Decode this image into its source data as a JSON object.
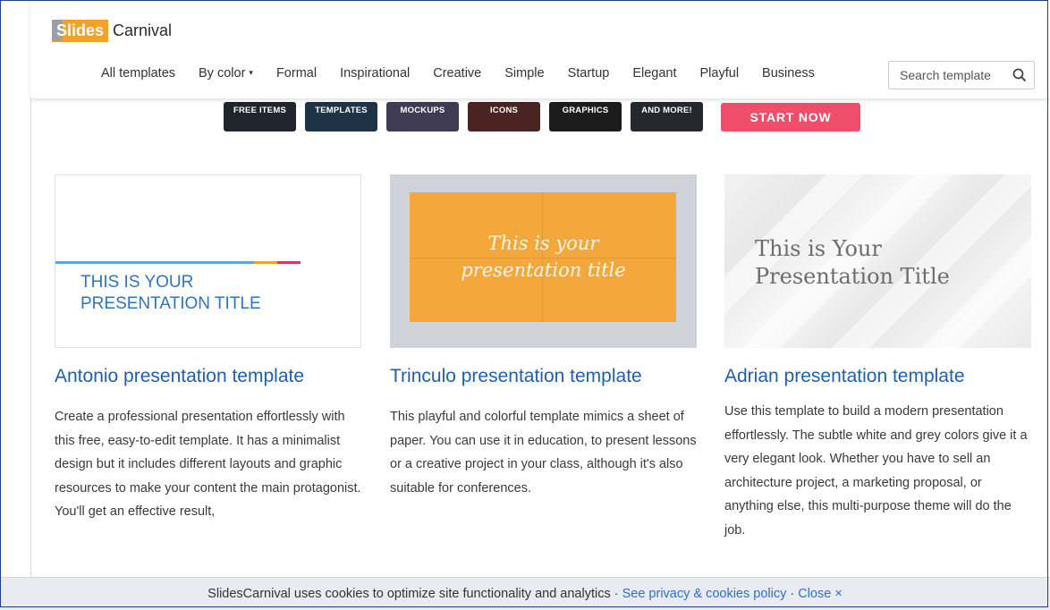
{
  "brand": {
    "slides": "Slides",
    "carnival": "Carnival",
    "accent": "#f2a12c"
  },
  "nav": {
    "items": [
      "All templates",
      "By color",
      "Formal",
      "Inspirational",
      "Creative",
      "Simple",
      "Startup",
      "Elegant",
      "Playful",
      "Business"
    ],
    "caret": "▾"
  },
  "search": {
    "placeholder": "Search template",
    "icon": "search-icon"
  },
  "banner": {
    "tiles": [
      {
        "label": "FREE ITEMS",
        "color": "#20242c"
      },
      {
        "label": "TEMPLATES",
        "color": "#1f3346"
      },
      {
        "label": "MOCKUPS",
        "color": "#3e3b52"
      },
      {
        "label": "ICONS",
        "color": "#4a2420"
      },
      {
        "label": "GRAPHICS",
        "color": "#1c1c1c"
      },
      {
        "label": "AND MORE!",
        "color": "#24282e"
      }
    ],
    "cta": "START NOW",
    "cta_color": "#ef4e6b"
  },
  "cards": [
    {
      "thumb_title_line1": "THIS IS YOUR",
      "thumb_title_line2": "PRESENTATION TITLE",
      "title": "Antonio presentation template",
      "description": "Create a professional presentation effortlessly with this free, easy-to-edit template. It has a minimalist design but it includes different layouts and graphic resources to make your content the main protagonist. You'll get an effective result,"
    },
    {
      "thumb_title_line1": "This is your",
      "thumb_title_line2": "presentation title",
      "title": "Trinculo presentation template",
      "description": "This playful and colorful template mimics a sheet of paper. You can use it in education, to present lessons or a creative project in your class, although it's also suitable for conferences."
    },
    {
      "thumb_title_line1": "This is Your",
      "thumb_title_line2": "Presentation Title",
      "title": "Adrian presentation template",
      "description": "Use this template to build a modern presentation effortlessly. The subtle white and grey colors give it a very elegant look. Whether you have to sell an architecture project, a marketing proposal, or anything else, this multi-purpose theme will do the job."
    }
  ],
  "cookie": {
    "text": "SlidesCarnival uses cookies to optimize site functionality and analytics · ",
    "policy_link": "See privacy & cookies policy",
    "separator": " · ",
    "close": "Close ×"
  },
  "colors": {
    "link_blue": "#1f5fae",
    "accent_orange": "#f4a73a",
    "cta_pink": "#ef4e6b"
  }
}
